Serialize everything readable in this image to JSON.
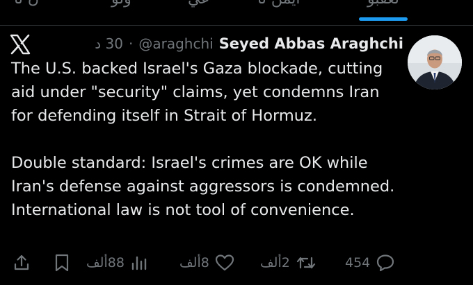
{
  "tabs": [
    {
      "label": "تعقبو",
      "active": true
    },
    {
      "label": "أيمن نا",
      "active": false
    },
    {
      "label": "عي",
      "active": false
    },
    {
      "label": "ولو",
      "active": false
    },
    {
      "label": "ن نا",
      "active": false
    }
  ],
  "post": {
    "author_name": "Seyed Abbas Araghchi",
    "handle": "@araghchi",
    "separator": "·",
    "time": "30 د",
    "paragraphs": [
      "The U.S. backed Israel's Gaza blockade, cutting aid under \"security\" claims, yet condemns Iran for defending itself in Strait of Hormuz.",
      "Double standard: Israel's crimes are OK while Iran's defense against aggressors is condemned. International law is not tool of convenience."
    ]
  },
  "actions": {
    "replies": "454",
    "reposts": "2ألف",
    "likes": "8ألف",
    "views": "88ألف"
  },
  "colors": {
    "background": "#000000",
    "text": "#e7e9ea",
    "muted": "#71767b",
    "accent": "#1d9bf0"
  },
  "icons": [
    "x-logo-icon",
    "reply-icon",
    "repost-icon",
    "like-icon",
    "views-icon",
    "bookmark-icon",
    "share-icon"
  ]
}
